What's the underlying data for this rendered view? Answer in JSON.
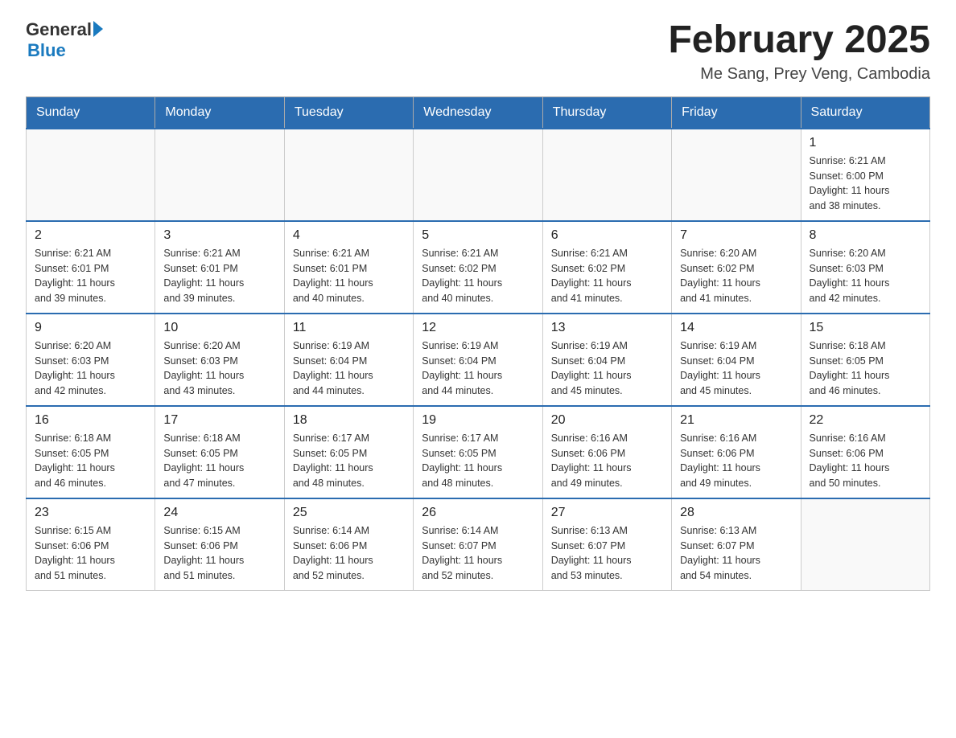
{
  "logo": {
    "general": "General",
    "blue": "Blue"
  },
  "header": {
    "title": "February 2025",
    "subtitle": "Me Sang, Prey Veng, Cambodia"
  },
  "weekdays": [
    "Sunday",
    "Monday",
    "Tuesday",
    "Wednesday",
    "Thursday",
    "Friday",
    "Saturday"
  ],
  "weeks": [
    [
      {
        "day": "",
        "info": ""
      },
      {
        "day": "",
        "info": ""
      },
      {
        "day": "",
        "info": ""
      },
      {
        "day": "",
        "info": ""
      },
      {
        "day": "",
        "info": ""
      },
      {
        "day": "",
        "info": ""
      },
      {
        "day": "1",
        "info": "Sunrise: 6:21 AM\nSunset: 6:00 PM\nDaylight: 11 hours\nand 38 minutes."
      }
    ],
    [
      {
        "day": "2",
        "info": "Sunrise: 6:21 AM\nSunset: 6:01 PM\nDaylight: 11 hours\nand 39 minutes."
      },
      {
        "day": "3",
        "info": "Sunrise: 6:21 AM\nSunset: 6:01 PM\nDaylight: 11 hours\nand 39 minutes."
      },
      {
        "day": "4",
        "info": "Sunrise: 6:21 AM\nSunset: 6:01 PM\nDaylight: 11 hours\nand 40 minutes."
      },
      {
        "day": "5",
        "info": "Sunrise: 6:21 AM\nSunset: 6:02 PM\nDaylight: 11 hours\nand 40 minutes."
      },
      {
        "day": "6",
        "info": "Sunrise: 6:21 AM\nSunset: 6:02 PM\nDaylight: 11 hours\nand 41 minutes."
      },
      {
        "day": "7",
        "info": "Sunrise: 6:20 AM\nSunset: 6:02 PM\nDaylight: 11 hours\nand 41 minutes."
      },
      {
        "day": "8",
        "info": "Sunrise: 6:20 AM\nSunset: 6:03 PM\nDaylight: 11 hours\nand 42 minutes."
      }
    ],
    [
      {
        "day": "9",
        "info": "Sunrise: 6:20 AM\nSunset: 6:03 PM\nDaylight: 11 hours\nand 42 minutes."
      },
      {
        "day": "10",
        "info": "Sunrise: 6:20 AM\nSunset: 6:03 PM\nDaylight: 11 hours\nand 43 minutes."
      },
      {
        "day": "11",
        "info": "Sunrise: 6:19 AM\nSunset: 6:04 PM\nDaylight: 11 hours\nand 44 minutes."
      },
      {
        "day": "12",
        "info": "Sunrise: 6:19 AM\nSunset: 6:04 PM\nDaylight: 11 hours\nand 44 minutes."
      },
      {
        "day": "13",
        "info": "Sunrise: 6:19 AM\nSunset: 6:04 PM\nDaylight: 11 hours\nand 45 minutes."
      },
      {
        "day": "14",
        "info": "Sunrise: 6:19 AM\nSunset: 6:04 PM\nDaylight: 11 hours\nand 45 minutes."
      },
      {
        "day": "15",
        "info": "Sunrise: 6:18 AM\nSunset: 6:05 PM\nDaylight: 11 hours\nand 46 minutes."
      }
    ],
    [
      {
        "day": "16",
        "info": "Sunrise: 6:18 AM\nSunset: 6:05 PM\nDaylight: 11 hours\nand 46 minutes."
      },
      {
        "day": "17",
        "info": "Sunrise: 6:18 AM\nSunset: 6:05 PM\nDaylight: 11 hours\nand 47 minutes."
      },
      {
        "day": "18",
        "info": "Sunrise: 6:17 AM\nSunset: 6:05 PM\nDaylight: 11 hours\nand 48 minutes."
      },
      {
        "day": "19",
        "info": "Sunrise: 6:17 AM\nSunset: 6:05 PM\nDaylight: 11 hours\nand 48 minutes."
      },
      {
        "day": "20",
        "info": "Sunrise: 6:16 AM\nSunset: 6:06 PM\nDaylight: 11 hours\nand 49 minutes."
      },
      {
        "day": "21",
        "info": "Sunrise: 6:16 AM\nSunset: 6:06 PM\nDaylight: 11 hours\nand 49 minutes."
      },
      {
        "day": "22",
        "info": "Sunrise: 6:16 AM\nSunset: 6:06 PM\nDaylight: 11 hours\nand 50 minutes."
      }
    ],
    [
      {
        "day": "23",
        "info": "Sunrise: 6:15 AM\nSunset: 6:06 PM\nDaylight: 11 hours\nand 51 minutes."
      },
      {
        "day": "24",
        "info": "Sunrise: 6:15 AM\nSunset: 6:06 PM\nDaylight: 11 hours\nand 51 minutes."
      },
      {
        "day": "25",
        "info": "Sunrise: 6:14 AM\nSunset: 6:06 PM\nDaylight: 11 hours\nand 52 minutes."
      },
      {
        "day": "26",
        "info": "Sunrise: 6:14 AM\nSunset: 6:07 PM\nDaylight: 11 hours\nand 52 minutes."
      },
      {
        "day": "27",
        "info": "Sunrise: 6:13 AM\nSunset: 6:07 PM\nDaylight: 11 hours\nand 53 minutes."
      },
      {
        "day": "28",
        "info": "Sunrise: 6:13 AM\nSunset: 6:07 PM\nDaylight: 11 hours\nand 54 minutes."
      },
      {
        "day": "",
        "info": ""
      }
    ]
  ]
}
